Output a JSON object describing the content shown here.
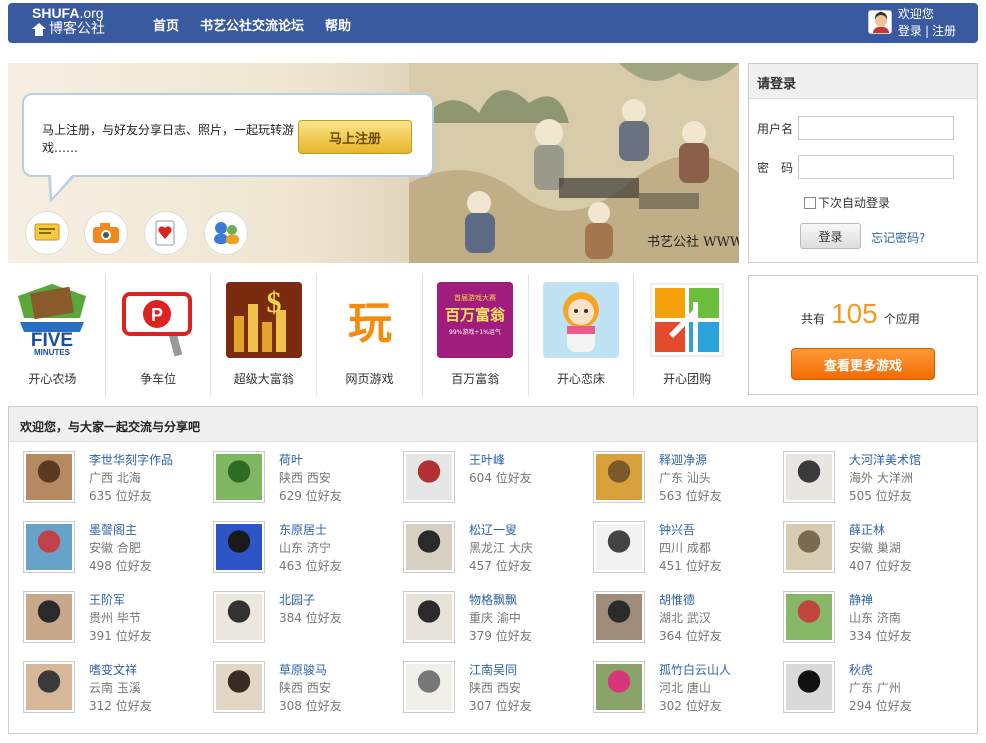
{
  "header": {
    "logo_top": "SHUFA",
    "logo_top_suffix": ".org",
    "logo_bottom": "博客公社",
    "nav": [
      "首页",
      "书艺公社交流论坛",
      "帮助"
    ],
    "welcome": "欢迎您",
    "login": "登录",
    "separator": "|",
    "register": "注册"
  },
  "banner": {
    "text": "马上注册，与好友分享日志、照片，一起玩转游戏……",
    "register_button": "马上注册",
    "icons": [
      "note-icon",
      "camera-icon",
      "playing-card-icon",
      "people-icon"
    ],
    "watermark": "书艺公社 WWW.SHUFA.ORG"
  },
  "login_box": {
    "title": "请登录",
    "username_label": "用户名",
    "password_label": "密　码",
    "remember": "下次自动登录",
    "submit": "登录",
    "forgot": "忘记密码?"
  },
  "apps": [
    {
      "label": "开心农场",
      "icon": "five-minutes-farm-icon",
      "badge": "FIVE",
      "badge2": "MINUTES"
    },
    {
      "label": "争车位",
      "icon": "parking-sign-icon",
      "badge": "P"
    },
    {
      "label": "超级大富翁",
      "icon": "gold-coins-icon",
      "badge": "$"
    },
    {
      "label": "网页游戏",
      "icon": "play-character-icon",
      "badge": "玩"
    },
    {
      "label": "百万富翁",
      "icon": "millionaire-icon",
      "badge": "百万富翁",
      "badge_top": "首届游戏大赛",
      "badge_sub": "99%游戏+1%运气"
    },
    {
      "label": "开心恋床",
      "icon": "cartoon-girl-icon"
    },
    {
      "label": "开心团购",
      "icon": "group-buy-icon"
    }
  ],
  "app_count": {
    "prefix": "共有",
    "count": "105",
    "suffix": "个应用",
    "button": "查看更多游戏"
  },
  "friends": {
    "title": "欢迎您，与大家一起交流与分享吧",
    "people": [
      {
        "name": "李世华刻字作品",
        "location": "广西 北海",
        "count": "635 位好友",
        "colors": [
          "#b58a62",
          "#5a3a22"
        ]
      },
      {
        "name": "荷叶",
        "location": "陕西 西安",
        "count": "629 位好友",
        "colors": [
          "#7fb661",
          "#2f6b24"
        ]
      },
      {
        "name": "王叶峰",
        "location": "",
        "count": "604 位好友",
        "colors": [
          "#e6e6e6",
          "#b23030"
        ]
      },
      {
        "name": "释迦净源",
        "location": "广东 汕头",
        "count": "563 位好友",
        "colors": [
          "#d9a13b",
          "#7a5a2a"
        ]
      },
      {
        "name": "大河洋美术馆",
        "location": "海外 大洋洲",
        "count": "505 位好友",
        "colors": [
          "#e9e6e1",
          "#3a3a3a"
        ]
      },
      {
        "name": "墨謦阁主",
        "location": "安徽 合肥",
        "count": "498 位好友",
        "colors": [
          "#67a3c9",
          "#c2404a"
        ]
      },
      {
        "name": "东原居士",
        "location": "山东 济宁",
        "count": "463 位好友",
        "colors": [
          "#2d55c8",
          "#1a1a1a"
        ]
      },
      {
        "name": "松辽一叟",
        "location": "黑龙江 大庆",
        "count": "457 位好友",
        "colors": [
          "#d6cfc2",
          "#2a2a2a"
        ]
      },
      {
        "name": "钟兴吾",
        "location": "四川 成都",
        "count": "451 位好友",
        "colors": [
          "#f2f2f2",
          "#444"
        ]
      },
      {
        "name": "薛正林",
        "location": "安徽 巢湖",
        "count": "407 位好友",
        "colors": [
          "#d7cbb3",
          "#7a6a52"
        ]
      },
      {
        "name": "王阶军",
        "location": "贵州 毕节",
        "count": "391 位好友",
        "colors": [
          "#c9a78b",
          "#2a2a2a"
        ]
      },
      {
        "name": "北园子",
        "location": "",
        "count": "384 位好友",
        "colors": [
          "#ece7dc",
          "#333"
        ]
      },
      {
        "name": "物格飘飘",
        "location": "重庆 渝中",
        "count": "379 位好友",
        "colors": [
          "#e7e2da",
          "#2b2b2b"
        ]
      },
      {
        "name": "胡惟德",
        "location": "湖北 武汉",
        "count": "364 位好友",
        "colors": [
          "#a08c7a",
          "#2b2b2b"
        ]
      },
      {
        "name": "静禅",
        "location": "山东 济南",
        "count": "334 位好友",
        "colors": [
          "#86b867",
          "#c0453c"
        ]
      },
      {
        "name": "嗜变文祥",
        "location": "云南 玉溪",
        "count": "312 位好友",
        "colors": [
          "#d6b799",
          "#3a3a3a"
        ]
      },
      {
        "name": "草原骏马",
        "location": "陕西 西安",
        "count": "308 位好友",
        "colors": [
          "#e2d6c4",
          "#3a2b22"
        ]
      },
      {
        "name": "江南吴同",
        "location": "陕西 西安",
        "count": "307 位好友",
        "colors": [
          "#f1efea",
          "#777"
        ]
      },
      {
        "name": "孤竹白云山人",
        "location": "河北 唐山",
        "count": "302 位好友",
        "colors": [
          "#89a36b",
          "#d8357a"
        ]
      },
      {
        "name": "秋虎",
        "location": "广东 广州",
        "count": "294 位好友",
        "colors": [
          "#d9d9d9",
          "#111"
        ]
      }
    ]
  }
}
